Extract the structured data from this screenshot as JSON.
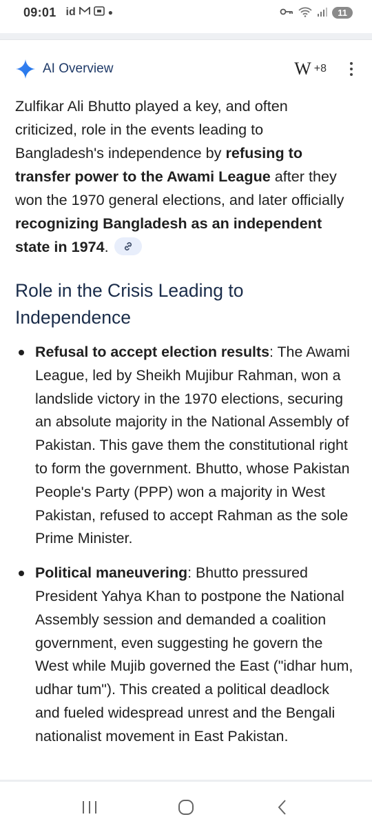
{
  "status_bar": {
    "time": "09:01",
    "left_icons": [
      "id-icon",
      "gmail-icon",
      "screenshot-icon",
      "dot-icon"
    ],
    "right_icons": [
      "vpn-key-icon",
      "wifi-icon",
      "signal-icon"
    ],
    "battery": "11"
  },
  "ai_overview": {
    "title": "AI Overview",
    "sources_count": "+8",
    "intro": {
      "p1": "Zulfikar Ali Bhutto played a key, and often criticized, role in the events leading to Bangladesh's independence by ",
      "b1": "refusing to transfer power to the Awami League",
      "p2": " after they won the 1970 general elections, and later officially ",
      "b2": "recognizing Bangladesh as an independent state in 1974",
      "p3": "."
    },
    "section_heading": "Role in the Crisis Leading to Independence",
    "bullets": [
      {
        "title": "Refusal to accept election results",
        "text": ": The Awami League, led by Sheikh Mujibur Rahman, won a landslide victory in the 1970 elections, securing an absolute majority in the National Assembly of Pakistan. This gave them the constitutional right to form the government. Bhutto, whose Pakistan People's Party (PPP) won a majority in West Pakistan, refused to accept Rahman as the sole Prime Minister."
      },
      {
        "title": "Political maneuvering",
        "text": ": Bhutto pressured President Yahya Khan to postpone the National Assembly session and demanded a coalition government, even suggesting he govern the West while Mujib governed the East (\"idhar hum, udhar tum\"). This created a political deadlock and fueled widespread unrest and the Bengali nationalist movement in East Pakistan."
      }
    ]
  },
  "nav": {
    "buttons": [
      "recent-apps-icon",
      "home-icon",
      "back-icon"
    ]
  }
}
